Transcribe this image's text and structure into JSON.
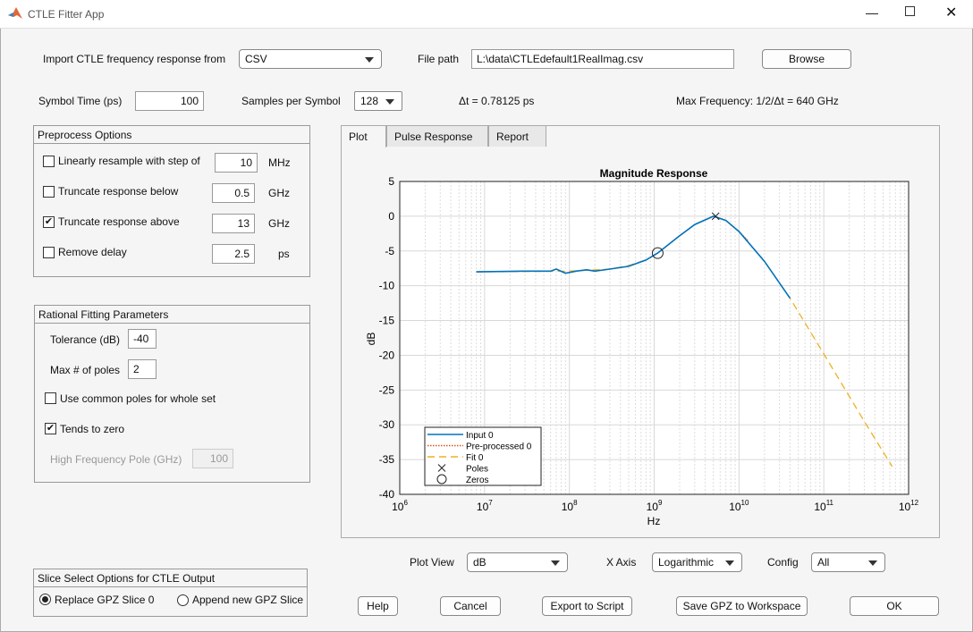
{
  "window": {
    "title": "CTLE Fitter App"
  },
  "import": {
    "label": "Import CTLE frequency response from",
    "source": "CSV",
    "file_path_label": "File path",
    "file_path": "L:\\data\\CTLEdefault1RealImag.csv",
    "browse": "Browse"
  },
  "symbol": {
    "label": "Symbol Time (ps)",
    "value": "100",
    "samples_label": "Samples per Symbol",
    "samples": "128",
    "dt": "Δt = 0.78125 ps",
    "maxfreq": "Max Frequency: 1/2/Δt = 640 GHz"
  },
  "preprocess": {
    "title": "Preprocess Options",
    "rows": [
      {
        "label": "Linearly resample with step of",
        "value": "10",
        "unit": "MHz",
        "checked": false
      },
      {
        "label": "Truncate response below",
        "value": "0.5",
        "unit": "GHz",
        "checked": false
      },
      {
        "label": "Truncate response above",
        "value": "13",
        "unit": "GHz",
        "checked": true
      },
      {
        "label": "Remove delay",
        "value": "2.5",
        "unit": "ps",
        "checked": false
      }
    ]
  },
  "rational": {
    "title": "Rational Fitting Parameters",
    "tolerance_label": "Tolerance (dB)",
    "tolerance": "-40",
    "maxpoles_label": "Max # of poles",
    "maxpoles": "2",
    "common_poles": "Use common poles for whole set",
    "common_checked": false,
    "tends_zero": "Tends to zero",
    "tends_checked": true,
    "hfp_label": "High Frequency Pole (GHz)",
    "hfp": "100"
  },
  "slice": {
    "title": "Slice Select Options for CTLE Output",
    "replace": "Replace GPZ Slice 0",
    "append": "Append new GPZ Slice",
    "selected": "replace"
  },
  "tabs": [
    {
      "label": "Plot",
      "active": true
    },
    {
      "label": "Pulse Response"
    },
    {
      "label": "Report"
    }
  ],
  "view": {
    "plot_view_label": "Plot View",
    "plot_view": "dB",
    "xaxis_label": "X Axis",
    "xaxis": "Logarithmic",
    "config_label": "Config",
    "config": "All"
  },
  "buttons": {
    "help": "Help",
    "cancel": "Cancel",
    "export": "Export to Script",
    "save": "Save GPZ to Workspace",
    "ok": "OK"
  },
  "chart_data": {
    "type": "line",
    "title": "Magnitude Response",
    "xlabel": "Hz",
    "ylabel": "dB",
    "xscale": "log",
    "xlim": [
      1000000.0,
      1000000000000.0
    ],
    "ylim": [
      -40,
      5
    ],
    "grid": true,
    "legend_placement": "bottom-left",
    "xticks": [
      "10^6",
      "10^7",
      "10^8",
      "10^9",
      "10^10",
      "10^11",
      "10^12"
    ],
    "yticks": [
      "5",
      "0",
      "-5",
      "-10",
      "-15",
      "-20",
      "-25",
      "-30",
      "-35",
      "-40"
    ],
    "series": [
      {
        "name": "Input 0",
        "color": "#0072bd",
        "style": "solid",
        "x": [
          8000000.0,
          30000000.0,
          60000000.0,
          70000000.0,
          90000000.0,
          120000000.0,
          160000000.0,
          200000000.0,
          300000000.0,
          500000000.0,
          800000000.0,
          1100000000.0,
          2000000000.0,
          3000000000.0,
          5000000000.0,
          7000000000.0,
          10000000000.0,
          20000000000.0,
          40000000000.0
        ],
        "y": [
          -8,
          -7.9,
          -7.9,
          -7.6,
          -8.2,
          -7.9,
          -7.7,
          -7.9,
          -7.6,
          -7.2,
          -6.3,
          -5.3,
          -2.8,
          -1.2,
          0,
          -0.6,
          -2.2,
          -6.5,
          -11.8
        ]
      },
      {
        "name": "Pre-processed 0",
        "color": "#d95319",
        "style": "dotted",
        "x": [
          8000000.0,
          30000000.0,
          60000000.0,
          70000000.0,
          90000000.0,
          120000000.0,
          160000000.0,
          200000000.0,
          300000000.0,
          500000000.0,
          800000000.0,
          1100000000.0,
          2000000000.0,
          3000000000.0,
          5000000000.0,
          7000000000.0,
          10000000000.0,
          13000000000.0
        ],
        "y": [
          -8,
          -7.9,
          -7.9,
          -7.6,
          -8.2,
          -7.9,
          -7.7,
          -7.9,
          -7.6,
          -7.2,
          -6.3,
          -5.3,
          -2.8,
          -1.2,
          0,
          -0.6,
          -2.2,
          -3.6
        ]
      },
      {
        "name": "Fit 0",
        "color": "#edb120",
        "style": "dashed",
        "x": [
          8000000.0,
          100000000.0,
          300000000.0,
          500000000.0,
          800000000.0,
          1100000000.0,
          2000000000.0,
          3000000000.0,
          5000000000.0,
          7000000000.0,
          10000000000.0,
          20000000000.0,
          40000000000.0,
          100000000000.0,
          300000000000.0,
          640000000000.0
        ],
        "y": [
          -8,
          -7.9,
          -7.6,
          -7.1,
          -6.3,
          -5.3,
          -2.8,
          -1.2,
          0,
          -0.6,
          -2.2,
          -6.5,
          -11.8,
          -19.8,
          -29.5,
          -36
        ]
      }
    ],
    "markers": [
      {
        "name": "Poles",
        "symbol": "x",
        "x": [
          5300000000.0
        ],
        "y": [
          0
        ]
      },
      {
        "name": "Zeros",
        "symbol": "o",
        "x": [
          1100000000.0
        ],
        "y": [
          -5.3
        ]
      }
    ]
  }
}
